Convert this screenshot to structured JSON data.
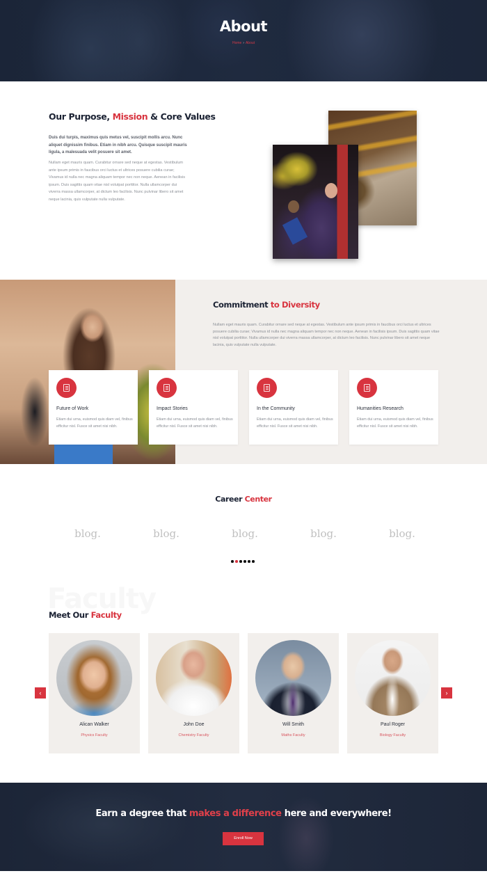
{
  "hero": {
    "title": "About",
    "breadcrumb": {
      "home": "Home",
      "separator": "›",
      "current": "About"
    }
  },
  "purpose": {
    "title_parts": [
      "Our Purpose, ",
      "Mission",
      " & Core Values"
    ],
    "lead": "Duis dui turpis, maximus quis metus vel, suscipit mollis arcu. Nunc aliquet dignissim finibus. Etiam in nibh arcu. Quisque suscipit mauris ligula, a malesuada velit posuere sit amet.",
    "body": "Nullam eget mauris quam. Curabitur ornare sed neque at egestas. Vestibulum ante ipsum primis in faucibus orci luctus et ultrices posuere cubilia curae; Vivamus id nulla nec magna aliquam tempor nec non neque. Aenean in facilisis ipsum. Duis sagittis quam vitae nisl volutpat porttitor. Nulla ullamcorper dui viverra massa ullamcorper, at dictum leo facilisis. Nunc pulvinar libero sit amet neque lacinia, quis vulputate nulla vulputate."
  },
  "diversity": {
    "title_parts": [
      "Commitment ",
      "to Diversity"
    ],
    "body": "Nullam eget mauris quam. Curabitur ornare sed neque at egestas. Vestibulum ante ipsum primis in faucibus orci luctus et ultrices posuere cubilia curae; Vivamus id nulla nec magna aliquam tempor nec non neque. Aenean in facilisis ipsum. Duis sagittis quam vitae nisl volutpat porttitor. Nulla ullamcorper dui viverra massa ullamcorper, at dictum leo facilisis. Nunc pulvinar libero sit amet neque lacinia, quis vulputate nulla vulputate.",
    "cards": [
      {
        "icon": "document-icon",
        "title": "Future of Work",
        "text": "Etiam dui urna, euismod quis diam vel, finibus efficitur nisl. Fusce sit amet nisi nibh."
      },
      {
        "icon": "document-icon",
        "title": "Impact Stories",
        "text": "Etiam dui urna, euismod quis diam vel, finibus efficitur nisl. Fusce sit amet nisi nibh."
      },
      {
        "icon": "document-icon",
        "title": "In the Community",
        "text": "Etiam dui urna, euismod quis diam vel, finibus efficitur nisl. Fusce sit amet nisi nibh."
      },
      {
        "icon": "document-icon",
        "title": "Humanities Research",
        "text": "Etiam dui urna, euismod quis diam vel, finibus efficitur nisl. Fusce sit amet nisi nibh."
      }
    ]
  },
  "career": {
    "title_parts": [
      "Career ",
      "Center"
    ],
    "logos": [
      "blog.",
      "blog.",
      "blog.",
      "blog.",
      "blog."
    ],
    "pagination": {
      "total": 6,
      "active_index": 1
    }
  },
  "faculty": {
    "watermark": "Faculty",
    "title_parts": [
      "Meet Our ",
      "Faculty"
    ],
    "prev_label": "‹",
    "next_label": "›",
    "members": [
      {
        "name": "Alican Walker",
        "dept": "Physics Faculty"
      },
      {
        "name": "John Doe",
        "dept": "Chemistry Faculty"
      },
      {
        "name": "Will Smith",
        "dept": "Maths Faculty"
      },
      {
        "name": "Paul Roger",
        "dept": "Biology Faculty"
      }
    ]
  },
  "cta": {
    "title_parts": [
      "Earn a degree that ",
      "makes a difference",
      " here and everywhere!"
    ],
    "button_label": "Enroll Now"
  },
  "colors": {
    "accent": "#d8343f",
    "dark": "#1b2233",
    "section_bg": "#f2efec"
  }
}
